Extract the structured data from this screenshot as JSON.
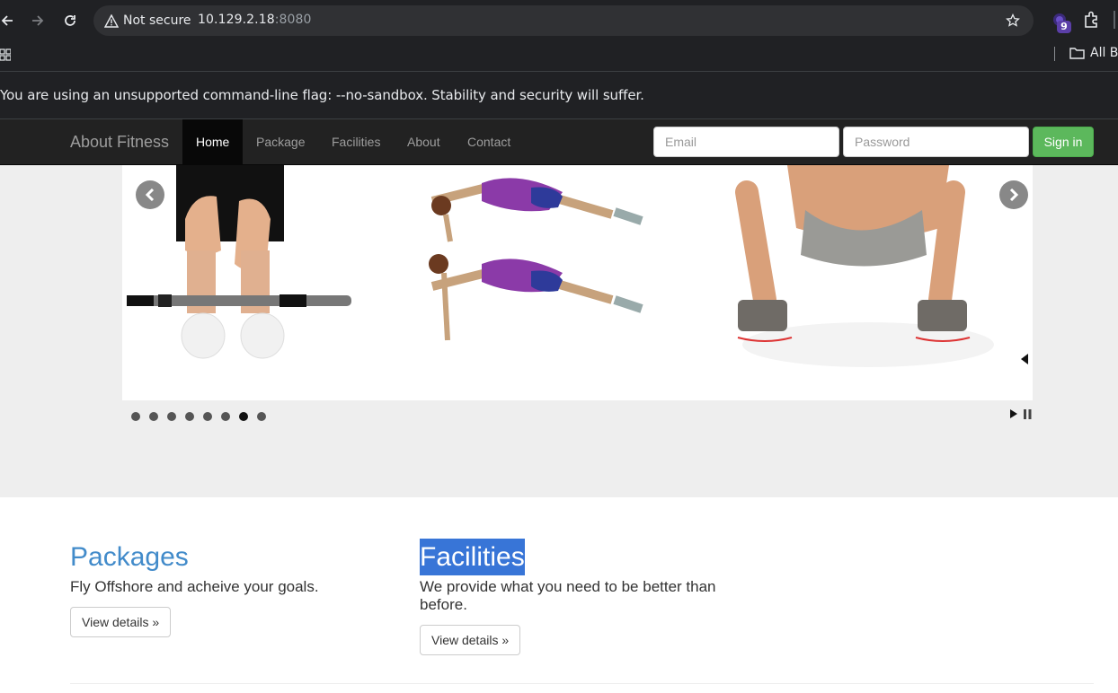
{
  "browser": {
    "security_label": "Not secure",
    "url_host": "10.129.2.18",
    "url_port": ":8080",
    "extension_badge": "9",
    "bookmarks_all_label": "All B",
    "infobar_text": "You are using an unsupported command-line flag: --no-sandbox. Stability and security will suffer."
  },
  "navbar": {
    "brand": "About Fitness",
    "items": [
      {
        "label": "Home",
        "active": true
      },
      {
        "label": "Package",
        "active": false
      },
      {
        "label": "Facilities",
        "active": false
      },
      {
        "label": "About",
        "active": false
      },
      {
        "label": "Contact",
        "active": false
      }
    ],
    "email_placeholder": "Email",
    "password_placeholder": "Password",
    "signin_label": "Sign in"
  },
  "carousel": {
    "slide_count": 8,
    "active_index": 6,
    "prev_icon": "chevron-left-icon",
    "next_icon": "chevron-right-icon"
  },
  "sections": [
    {
      "heading": "Packages",
      "text": "Fly Offshore and acheive your goals.",
      "button": "View details »",
      "selected": false
    },
    {
      "heading": "Facilities",
      "text": "We provide what you need to be better than before.",
      "button": "View details »",
      "selected": true
    }
  ],
  "colors": {
    "navbar_bg": "#222222",
    "link_blue": "#428bca",
    "success_green": "#5cb85c",
    "hero_bg": "#eeeeee",
    "selection": "#3875d7"
  }
}
